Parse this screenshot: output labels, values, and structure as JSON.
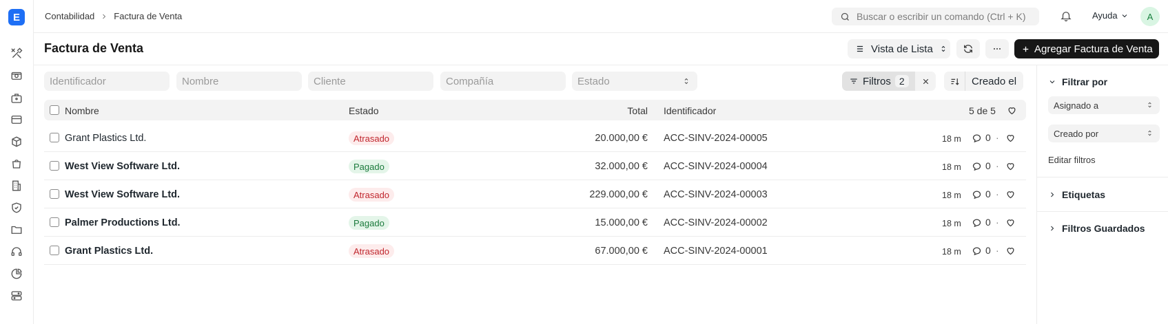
{
  "app": {
    "logo_letter": "E",
    "accent_color": "#1e6ff5",
    "rail_icons": [
      "tools-icon",
      "camera-money-icon",
      "briefcase-icon",
      "credit-card-icon",
      "box-icon",
      "shopping-bag-icon",
      "building-icon",
      "shield-check-icon",
      "folder-icon",
      "headset-icon",
      "pie-chart-icon",
      "server-icon"
    ]
  },
  "topbar": {
    "breadcrumbs": [
      "Contabilidad",
      "Factura de Venta"
    ],
    "search_placeholder": "Buscar o escribir un comando (Ctrl + K)",
    "help_label": "Ayuda",
    "avatar_letter": "A"
  },
  "header": {
    "title": "Factura de Venta",
    "view_label": "Vista de Lista",
    "add_label": "Agregar Factura de Venta"
  },
  "filters": {
    "identificador_placeholder": "Identificador",
    "nombre_placeholder": "Nombre",
    "cliente_placeholder": "Cliente",
    "compania_placeholder": "Compañía",
    "estado_placeholder": "Estado",
    "filters_label": "Filtros",
    "filters_count": "2",
    "sort_label": "Creado el"
  },
  "list": {
    "columns": {
      "nombre": "Nombre",
      "estado": "Estado",
      "total": "Total",
      "identificador": "Identificador"
    },
    "count": "5 de 5",
    "rows": [
      {
        "name": "Grant Plastics Ltd.",
        "status": "Atrasado",
        "status_color": "red",
        "bold": false,
        "total": "20.000,00 €",
        "id": "ACC-SINV-2024-00005",
        "ago": "18 m",
        "comments": "0"
      },
      {
        "name": "West View Software Ltd.",
        "status": "Pagado",
        "status_color": "green",
        "bold": true,
        "total": "32.000,00 €",
        "id": "ACC-SINV-2024-00004",
        "ago": "18 m",
        "comments": "0"
      },
      {
        "name": "West View Software Ltd.",
        "status": "Atrasado",
        "status_color": "red",
        "bold": true,
        "total": "229.000,00 €",
        "id": "ACC-SINV-2024-00003",
        "ago": "18 m",
        "comments": "0"
      },
      {
        "name": "Palmer Productions Ltd.",
        "status": "Pagado",
        "status_color": "green",
        "bold": true,
        "total": "15.000,00 €",
        "id": "ACC-SINV-2024-00002",
        "ago": "18 m",
        "comments": "0"
      },
      {
        "name": "Grant Plastics Ltd.",
        "status": "Atrasado",
        "status_color": "red",
        "bold": true,
        "total": "67.000,00 €",
        "id": "ACC-SINV-2024-00001",
        "ago": "18 m",
        "comments": "0"
      }
    ]
  },
  "sidebar": {
    "filter_by": "Filtrar por",
    "assigned_to": "Asignado a",
    "created_by": "Creado por",
    "edit_filters": "Editar filtros",
    "tags": "Etiquetas",
    "saved_filters": "Filtros Guardados"
  }
}
